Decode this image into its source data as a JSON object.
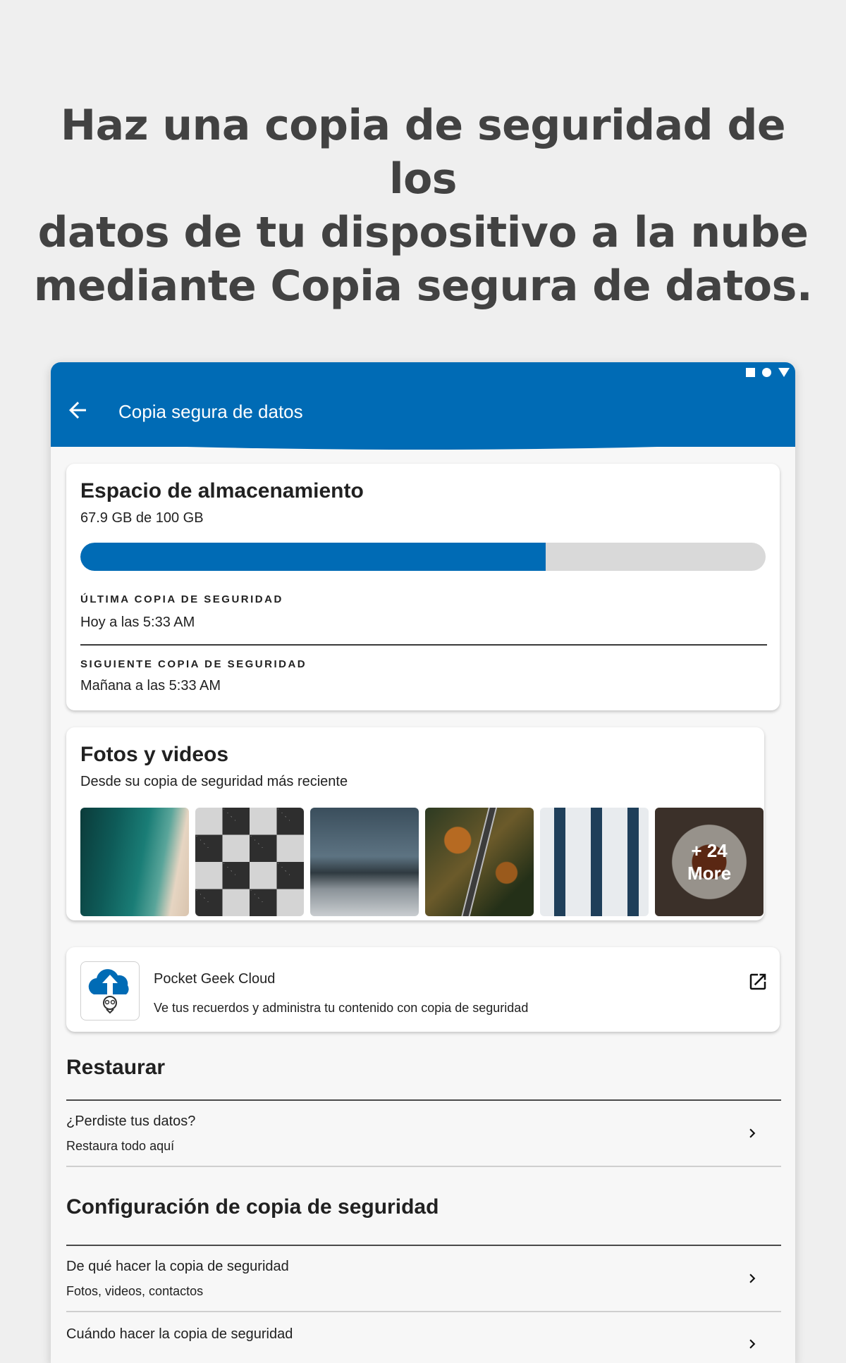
{
  "promo": {
    "line1": "Haz una copia de seguridad de los",
    "line2": "datos de tu dispositivo a la nube",
    "line3": "mediante Copia segura de datos."
  },
  "appbar": {
    "title": "Copia segura de datos",
    "back_icon": "arrow-left-icon",
    "status_icons": [
      "square-icon",
      "circle-icon",
      "triangle-icon"
    ],
    "color": "#006bb5"
  },
  "storage": {
    "title": "Espacio de almacenamiento",
    "usage_text": "67.9 GB de 100 GB",
    "used_fraction": 0.679,
    "last_backup_label": "ÚLTIMA COPIA DE SEGURIDAD",
    "last_backup_value": "Hoy a las 5:33 AM",
    "next_backup_label": "SIGUIENTE COPIA DE SEGURIDAD",
    "next_backup_value": "Mañana a las 5:33 AM"
  },
  "photos": {
    "title": "Fotos y videos",
    "subtitle": "Desde su copia de seguridad más reciente",
    "more_count": "+ 24",
    "more_label": "More"
  },
  "cloud": {
    "title": "Pocket Geek Cloud",
    "subtitle": "Ve tus recuerdos y administra tu contenido con copia de seguridad",
    "logo_icon": "cloud-upload-icon",
    "link_icon": "open-external-icon"
  },
  "restore": {
    "heading": "Restaurar",
    "item_title": "¿Perdiste tus datos?",
    "item_sub": "Restaura todo aquí"
  },
  "settings": {
    "heading": "Configuración de copia de seguridad",
    "items": [
      {
        "title": "De qué hacer la copia de seguridad",
        "sub": "Fotos, videos, contactos"
      },
      {
        "title": "Cuándo hacer la copia de seguridad",
        "sub": ""
      }
    ]
  }
}
